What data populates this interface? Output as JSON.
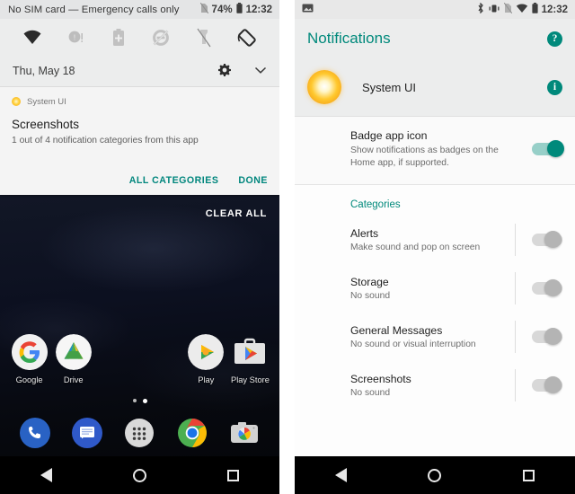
{
  "left_phone": {
    "status_bar": {
      "carrier_text": "No SIM card — Emergency calls only",
      "battery_percent": "74%",
      "time": "12:32",
      "icons": [
        "no-sim-icon",
        "battery-icon"
      ]
    },
    "quick_settings": [
      {
        "name": "wifi-tile",
        "state": "on"
      },
      {
        "name": "cellular-data-tile",
        "state": "off"
      },
      {
        "name": "battery-saver-tile",
        "state": "off"
      },
      {
        "name": "do-not-disturb-tile",
        "state": "off"
      },
      {
        "name": "flashlight-tile",
        "state": "off"
      },
      {
        "name": "auto-rotate-tile",
        "state": "on"
      }
    ],
    "date_row": {
      "date": "Thu, May 18",
      "settings_icon": "gear-icon",
      "expand_icon": "chevron-down-icon"
    },
    "notification": {
      "app_name": "System UI",
      "title": "Screenshots",
      "subtitle": "1 out of 4 notification categories from this app",
      "action_all": "ALL CATEGORIES",
      "action_done": "DONE",
      "accent_color": "#00867d"
    },
    "clear_all": "CLEAR ALL",
    "home_apps": [
      {
        "label": "Google",
        "icon": "google-icon"
      },
      {
        "label": "Drive",
        "icon": "google-drive-icon"
      },
      {
        "label": "Play",
        "icon": "google-play-music-icon"
      },
      {
        "label": "Play Store",
        "icon": "play-store-icon"
      }
    ],
    "page_dots": {
      "count": 2,
      "active_index": 1
    },
    "dock_apps": [
      {
        "label": "Phone",
        "icon": "phone-icon"
      },
      {
        "label": "Messages",
        "icon": "messages-icon"
      },
      {
        "label": "All apps",
        "icon": "app-drawer-icon"
      },
      {
        "label": "Chrome",
        "icon": "chrome-icon"
      },
      {
        "label": "Camera",
        "icon": "camera-icon"
      }
    ],
    "nav_bar": [
      "back-button",
      "home-button",
      "recents-button"
    ]
  },
  "right_phone": {
    "status_bar": {
      "time": "12:32",
      "icons": [
        "screenshot-icon",
        "bluetooth-icon",
        "vibrate-icon",
        "no-sim-icon",
        "wifi-icon",
        "battery-icon"
      ]
    },
    "header": {
      "title": "Notifications",
      "help_icon_label": "?",
      "accent_color": "#00897b"
    },
    "app_row": {
      "name": "System UI",
      "info_icon_label": "i"
    },
    "badge_setting": {
      "title": "Badge app icon",
      "description": "Show notifications as badges on the Home app, if supported.",
      "state": "on"
    },
    "categories_label": "Categories",
    "categories": [
      {
        "title": "Alerts",
        "description": "Make sound and pop on screen",
        "state": "off"
      },
      {
        "title": "Storage",
        "description": "No sound",
        "state": "off"
      },
      {
        "title": "General Messages",
        "description": "No sound or visual interruption",
        "state": "off"
      },
      {
        "title": "Screenshots",
        "description": "No sound",
        "state": "off"
      }
    ],
    "nav_bar": [
      "back-button",
      "home-button",
      "recents-button"
    ]
  }
}
